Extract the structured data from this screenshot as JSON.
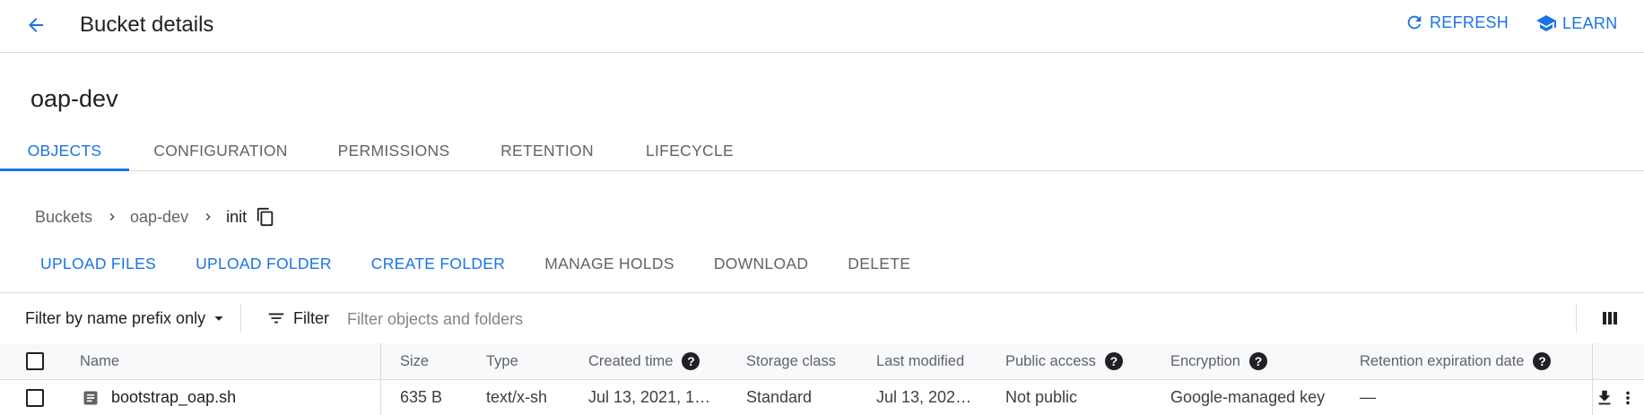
{
  "header": {
    "title": "Bucket details",
    "refresh_label": "REFRESH",
    "learn_label": "LEARN"
  },
  "bucket": {
    "name": "oap-dev"
  },
  "tabs": [
    {
      "label": "OBJECTS",
      "active": true
    },
    {
      "label": "CONFIGURATION",
      "active": false
    },
    {
      "label": "PERMISSIONS",
      "active": false
    },
    {
      "label": "RETENTION",
      "active": false
    },
    {
      "label": "LIFECYCLE",
      "active": false
    }
  ],
  "breadcrumb": [
    "Buckets",
    "oap-dev",
    "init"
  ],
  "actions": [
    {
      "label": "UPLOAD FILES",
      "enabled": true
    },
    {
      "label": "UPLOAD FOLDER",
      "enabled": true
    },
    {
      "label": "CREATE FOLDER",
      "enabled": true
    },
    {
      "label": "MANAGE HOLDS",
      "enabled": false
    },
    {
      "label": "DOWNLOAD",
      "enabled": false
    },
    {
      "label": "DELETE",
      "enabled": false
    }
  ],
  "filter": {
    "mode_label": "Filter by name prefix only",
    "filter_label": "Filter",
    "placeholder": "Filter objects and folders"
  },
  "table": {
    "columns": [
      "Name",
      "Size",
      "Type",
      "Created time",
      "Storage class",
      "Last modified",
      "Public access",
      "Encryption",
      "Retention expiration date"
    ],
    "rows": [
      {
        "name": "bootstrap_oap.sh",
        "size": "635 B",
        "type": "text/x-sh",
        "created": "Jul 13, 2021, 1…",
        "storage_class": "Standard",
        "last_modified": "Jul 13, 202…",
        "public_access": "Not public",
        "encryption": "Google-managed key",
        "retention": "—"
      }
    ]
  },
  "colors": {
    "accent": "#1a73e8",
    "text": "#202124",
    "muted": "#5f6368",
    "divider": "#dadce0"
  }
}
